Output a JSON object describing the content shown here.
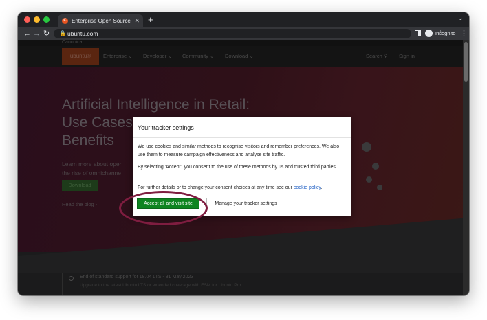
{
  "browser": {
    "tab_title": "Enterprise Open Source and L",
    "tab_close": "✕",
    "new_tab": "+",
    "tab_menu": "⌄",
    "favicon": "C",
    "url": "ubuntu.com",
    "profile_label": "Incognito",
    "icons": {
      "back": "←",
      "forward": "→",
      "reload": "↻",
      "lock": "🔒",
      "star": "☆",
      "menu": "⋮"
    }
  },
  "site": {
    "canonical": "Canonical",
    "logo": "ubuntu®",
    "nav": {
      "enterprise": "Enterprise ⌄",
      "developer": "Developer ⌄",
      "community": "Community ⌄",
      "download": "Download ⌄",
      "search": "Search ⚲",
      "signin": "Sign in"
    },
    "hero": {
      "title_line1": "Artificial Intelligence in Retail:",
      "title_line2": "Use Cases,",
      "title_line3": "Benefits",
      "sub_line1": "Learn more about oper",
      "sub_line2": "the rise of omnichanne",
      "button": "Download",
      "link": "Read the blog ›"
    },
    "notice": {
      "title": "End of standard support for 18.04 LTS - 31 May 2023",
      "text": "Upgrade to the latest Ubuntu LTS or extended coverage with ESM for Ubuntu Pro"
    }
  },
  "dialog": {
    "title": "Your tracker settings",
    "p1": "We use cookies and similar methods to recognise visitors and remember preferences. We also use them to measure campaign effectiveness and analyse site traffic.",
    "p2": "By selecting 'Accept', you consent to the use of these methods by us and trusted third parties.",
    "p3_prefix": "For further details or to change your consent choices at any time see our ",
    "p3_link": "cookie policy",
    "p3_suffix": ".",
    "accept_button": "Accept all and visit site",
    "manage_button": "Manage your tracker settings"
  },
  "colors": {
    "accept": "#0e8420",
    "annotation": "#7f1d40",
    "link": "#1f5fc4",
    "ubuntu_orange": "#e95420"
  }
}
